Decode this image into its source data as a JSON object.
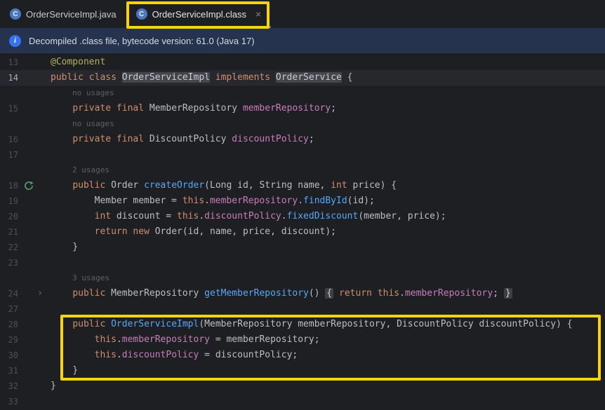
{
  "tabs": [
    {
      "label": "OrderServiceImpl.java",
      "icon_letter": "C",
      "active": false
    },
    {
      "label": "OrderServiceImpl.class",
      "icon_letter": "C",
      "active": true,
      "close_glyph": "×"
    }
  ],
  "banner": {
    "icon_glyph": "i",
    "text": "Decompiled .class file, bytecode version: 61.0 (Java 17)"
  },
  "icons": {
    "fold_arrow": "›",
    "close": "×",
    "info": "info-icon",
    "run": "green-recompile-arrow-icon"
  },
  "colors": {
    "accent_blue": "#3574f0",
    "annotation_highlight_yellow": "#f5d408",
    "banner_bg": "#25334f",
    "editor_bg": "#1e1f22",
    "caret_line_bg": "#26282e",
    "keyword": "#cf8e6d",
    "field": "#c77dbb",
    "method": "#56a8f5",
    "annotation": "#b3ae60",
    "plain_text": "#bcbec4",
    "line_number": "#4b5059",
    "inlay_hint": "#5c6066",
    "run_icon_green": "#57965c"
  },
  "editor": {
    "rows": [
      {
        "n": "13",
        "seg": [
          [
            "a",
            "@Component"
          ]
        ]
      },
      {
        "n": "14",
        "caret": true,
        "seg": [
          [
            "k",
            "public class "
          ],
          [
            "hb",
            "OrderServiceImpl"
          ],
          [
            "k",
            " implements "
          ],
          [
            "hb",
            "OrderService"
          ],
          [
            "t",
            " {"
          ]
        ]
      },
      {
        "inlay": "no usages"
      },
      {
        "n": "15",
        "seg": [
          [
            "t",
            "    "
          ],
          [
            "k",
            "private final "
          ],
          [
            "t",
            "MemberRepository "
          ],
          [
            "f",
            "memberRepository"
          ],
          [
            "t",
            ";"
          ]
        ]
      },
      {
        "inlay": "no usages"
      },
      {
        "n": "16",
        "seg": [
          [
            "t",
            "    "
          ],
          [
            "k",
            "private final "
          ],
          [
            "t",
            "DiscountPolicy "
          ],
          [
            "f",
            "discountPolicy"
          ],
          [
            "t",
            ";"
          ]
        ]
      },
      {
        "n": "17",
        "seg": []
      },
      {
        "inlay": "2 usages"
      },
      {
        "n": "18",
        "icon": "run",
        "seg": [
          [
            "t",
            "    "
          ],
          [
            "k",
            "public "
          ],
          [
            "t",
            "Order "
          ],
          [
            "m",
            "createOrder"
          ],
          [
            "t",
            "(Long id, String name, "
          ],
          [
            "k",
            "int"
          ],
          [
            "t",
            " price) {"
          ]
        ]
      },
      {
        "n": "19",
        "seg": [
          [
            "t",
            "        Member member = "
          ],
          [
            "k",
            "this"
          ],
          [
            "t",
            "."
          ],
          [
            "f",
            "memberRepository"
          ],
          [
            "t",
            "."
          ],
          [
            "m",
            "findById"
          ],
          [
            "t",
            "(id);"
          ]
        ]
      },
      {
        "n": "20",
        "seg": [
          [
            "t",
            "        "
          ],
          [
            "k",
            "int"
          ],
          [
            "t",
            " discount = "
          ],
          [
            "k",
            "this"
          ],
          [
            "t",
            "."
          ],
          [
            "f",
            "discountPolicy"
          ],
          [
            "t",
            "."
          ],
          [
            "m",
            "fixedDiscount"
          ],
          [
            "t",
            "(member, price);"
          ]
        ]
      },
      {
        "n": "21",
        "seg": [
          [
            "t",
            "        "
          ],
          [
            "k",
            "return new "
          ],
          [
            "t",
            "Order(id, name, price, discount);"
          ]
        ]
      },
      {
        "n": "22",
        "seg": [
          [
            "t",
            "    }"
          ]
        ]
      },
      {
        "n": "23",
        "seg": []
      },
      {
        "inlay": "3 usages"
      },
      {
        "n": "24",
        "fold": true,
        "seg": [
          [
            "t",
            "    "
          ],
          [
            "k",
            "public "
          ],
          [
            "t",
            "MemberRepository "
          ],
          [
            "m",
            "getMemberRepository"
          ],
          [
            "t",
            "() "
          ],
          [
            "fb",
            "{"
          ],
          [
            "t",
            " "
          ],
          [
            "k",
            "return this"
          ],
          [
            "t",
            "."
          ],
          [
            "f",
            "memberRepository"
          ],
          [
            "t",
            "; "
          ],
          [
            "fb",
            "}"
          ]
        ]
      },
      {
        "n": "27",
        "seg": []
      },
      {
        "n": "28",
        "seg": [
          [
            "t",
            "    "
          ],
          [
            "k",
            "public "
          ],
          [
            "m",
            "OrderServiceImpl"
          ],
          [
            "t",
            "(MemberRepository memberRepository, DiscountPolicy discountPolicy) {"
          ]
        ]
      },
      {
        "n": "29",
        "seg": [
          [
            "t",
            "        "
          ],
          [
            "k",
            "this"
          ],
          [
            "t",
            "."
          ],
          [
            "f",
            "memberRepository"
          ],
          [
            "t",
            " = memberRepository;"
          ]
        ]
      },
      {
        "n": "30",
        "seg": [
          [
            "t",
            "        "
          ],
          [
            "k",
            "this"
          ],
          [
            "t",
            "."
          ],
          [
            "f",
            "discountPolicy"
          ],
          [
            "t",
            " = discountPolicy;"
          ]
        ]
      },
      {
        "n": "31",
        "seg": [
          [
            "t",
            "    }"
          ]
        ]
      },
      {
        "n": "32",
        "seg": [
          [
            "t",
            "}"
          ]
        ]
      },
      {
        "n": "33",
        "seg": []
      }
    ]
  }
}
